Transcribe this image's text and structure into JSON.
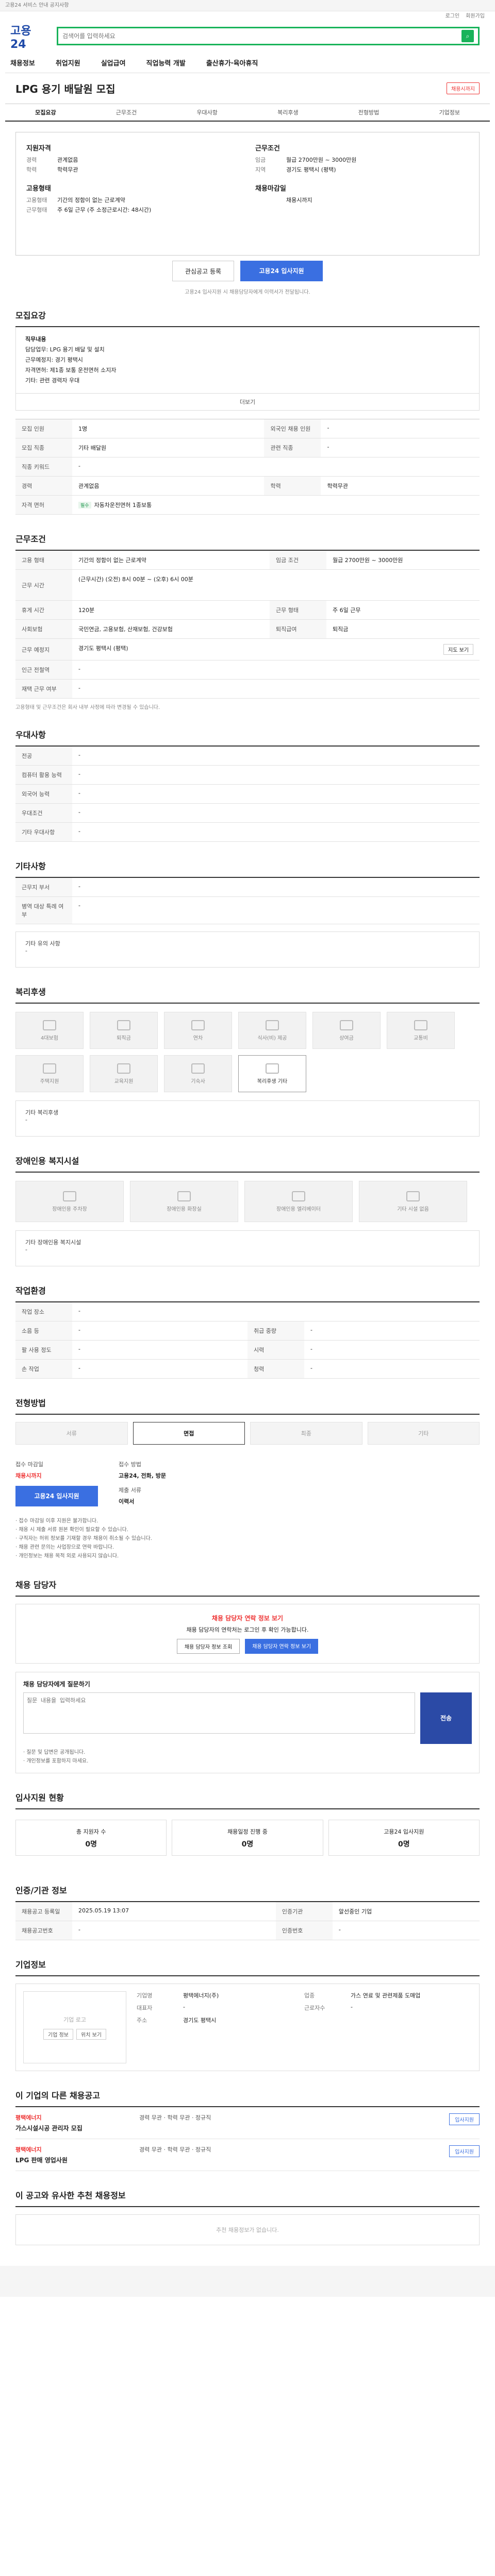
{
  "top": {
    "notice": "고용24 서비스 안내 공지사항",
    "logo": "고용24",
    "search_placeholder": "검색어를 입력하세요",
    "search_btn": "검색",
    "util": [
      "로그인",
      "회원가입"
    ],
    "gnb": [
      "채용정보",
      "취업지원",
      "실업급여",
      "직업능력 개발",
      "출산휴가·육아휴직"
    ]
  },
  "header": {
    "title": "LPG 용기 배달원 모집",
    "badge": "채용시까지",
    "tabs": [
      "모집요강",
      "근무조건",
      "우대사항",
      "복리후생",
      "전형방법",
      "기업정보"
    ]
  },
  "summary": {
    "left": [
      {
        "h": "지원자격",
        "lines": [
          [
            "경력",
            "관계없음"
          ],
          [
            "학력",
            "학력무관"
          ]
        ]
      },
      {
        "h": "고용형태",
        "lines": [
          [
            "고용형태",
            "기간의 정함이 없는 근로계약"
          ],
          [
            "근무형태",
            "주 6일 근무 (주 소정근로시간: 48시간)"
          ]
        ]
      }
    ],
    "right": [
      {
        "h": "근무조건",
        "lines": [
          [
            "임금",
            "월급 2700만원 ~ 3000만원"
          ],
          [
            "지역",
            "경기도 평택시 (평택)"
          ]
        ]
      },
      {
        "h": "채용마감일",
        "lines": [
          [
            "",
            "채용시까지"
          ]
        ]
      }
    ],
    "btn_save": "관심공고 등록",
    "btn_apply": "고용24 입사지원",
    "fine": "고용24 입사지원 시 채용담당자에게 이력서가 전달됩니다."
  },
  "recruit": {
    "h": "모집요강",
    "desc_title": "직무내용",
    "desc": [
      "담당업무: LPG 용기 배달 및 설치",
      "근무예정지: 경기 평택시",
      "자격면허: 제1종 보통 운전면허 소지자",
      "기타: 관련 경력자 우대"
    ],
    "more": "더보기",
    "rows": [
      [
        "모집 인원",
        "1명",
        "외국인 채용 인원",
        "-"
      ],
      [
        "모집 직종",
        "기타 배달원",
        "관련 직종",
        "-"
      ],
      [
        "직종 키워드",
        "-",
        "",
        ""
      ],
      [
        "경력",
        "관계없음",
        "학력",
        "학력무관"
      ],
      [
        "자격 면허",
        "자동차운전면허 1종보통",
        "",
        ""
      ]
    ],
    "tags": [
      "필수",
      "필수"
    ]
  },
  "work": {
    "h": "근무조건",
    "rows": [
      [
        "고용 형태",
        "기간의 정함이 없는 근로계약",
        "임금 조건",
        "월급 2700만원 ~ 3000만원"
      ],
      [
        "근무 시간",
        "(근무시간) (오전) 8시 00분 ~ (오후) 6시 00분",
        "",
        ""
      ],
      [
        "휴게 시간",
        "120분",
        "근무 형태",
        "주 6일 근무"
      ],
      [
        "사회보험",
        "국민연금, 고용보험, 산재보험, 건강보험",
        "퇴직급여",
        "퇴직금"
      ],
      [
        "근무 예정지",
        "경기도 평택시 (평택)",
        "",
        ""
      ],
      [
        "인근 전철역",
        "-",
        "",
        ""
      ],
      [
        "재택 근무 여부",
        "-",
        "",
        ""
      ]
    ],
    "map_btn": "지도 보기",
    "note": "고용형태 및 근무조건은 회사 내부 사정에 따라 변경될 수 있습니다."
  },
  "pref": {
    "h": "우대사항",
    "rows": [
      [
        "전공",
        "-"
      ],
      [
        "컴퓨터 활용 능력",
        "-"
      ],
      [
        "외국어 능력",
        "-"
      ],
      [
        "우대조건",
        "-"
      ],
      [
        "기타 우대사항",
        "-"
      ]
    ]
  },
  "etc": {
    "h": "기타사항",
    "rows": [
      [
        "근무지 부서",
        "-"
      ],
      [
        "병역 대상 특례 여부",
        "-"
      ]
    ],
    "box_title": "기타 유의 사항",
    "box_body": "-"
  },
  "welfare": {
    "h": "복리후생",
    "items": [
      "4대보험",
      "퇴직금",
      "연차",
      "식사(비) 제공",
      "상여금",
      "교통비",
      "주택지원",
      "교육지원",
      "기숙사",
      "복리후생 기타"
    ],
    "box_title": "기타 복리후생",
    "box_body": "-"
  },
  "disabled": {
    "h": "장애인용 복지시설",
    "items": [
      "장애인용 주차장",
      "장애인용 화장실",
      "장애인용 엘리베이터",
      "기타 시설 없음"
    ],
    "box_title": "기타 장애인용 복지시설",
    "box_body": "-"
  },
  "env": {
    "h": "작업환경",
    "rows": [
      [
        "작업 장소",
        "-",
        "",
        ""
      ],
      [
        "소음 등",
        "-",
        "취급 중량",
        "-"
      ],
      [
        "팔 사용 정도",
        "-",
        "시력",
        "-"
      ],
      [
        "손 작업",
        "-",
        "청력",
        "-"
      ]
    ]
  },
  "process": {
    "h": "전형방법",
    "steps": [
      "서류",
      "면접",
      "최종",
      "기타"
    ],
    "apply": [
      {
        "k": "접수 마감일",
        "v": "채용시까지"
      },
      {
        "k": "접수 방법",
        "v": "고용24, 전화, 방문"
      },
      {
        "k": "제출 서류",
        "v": "이력서"
      }
    ],
    "apply_btn": "고용24 입사지원",
    "notes": [
      "· 접수 마감일 이후 지원은 불가합니다.",
      "· 채용 시 제출 서류 원본 확인이 필요할 수 있습니다.",
      "· 구직자는 허위 정보를 기재할 경우 채용이 취소될 수 있습니다.",
      "· 채용 관련 문의는 사업장으로 연락 바랍니다.",
      "· 개인정보는 채용 목적 외로 사용되지 않습니다."
    ]
  },
  "contact": {
    "h": "채용 담당자",
    "warn": "채용 담당자 연락 정보 보기",
    "desc": "채용 담당자의 연락처는 로그인 후 확인 가능합니다.",
    "btn1": "채용 담당자 정보 조회",
    "btn2": "채용 담당자 연락 정보 보기",
    "q_title": "채용 담당자에게 질문하기",
    "q_placeholder": "질문 내용을 입력하세요",
    "q_send": "전송",
    "q_notes": [
      "· 질문 및 답변은 공개됩니다.",
      "· 개인정보를 포함하지 마세요."
    ]
  },
  "status": {
    "h": "입사지원 현황",
    "items": [
      {
        "k": "총 지원자 수",
        "v": "0명"
      },
      {
        "k": "채용일정 진행 중",
        "v": "0명"
      },
      {
        "k": "고용24 입사지원",
        "v": "0명"
      }
    ]
  },
  "reg": {
    "h": "인증/기관 정보",
    "rows": [
      [
        "채용공고 등록일",
        "2025.05.19 13:07",
        "인증기관",
        "알선중인 기업"
      ],
      [
        "채용공고번호",
        "-",
        "인증번호",
        "-"
      ]
    ]
  },
  "company": {
    "h": "기업정보",
    "logo_alt": "기업 로고",
    "mini": [
      "기업 정보",
      "위치 보기"
    ],
    "grid": [
      [
        "기업명",
        "평택에너지(주)",
        "업종",
        "가스 연료 및 관련제품 도매업"
      ],
      [
        "대표자",
        "-",
        "근로자수",
        "-"
      ],
      [
        "주소",
        "경기도 평택시",
        "",
        ""
      ]
    ]
  },
  "others": {
    "h": "이 기업의 다른 채용공고",
    "jobs": [
      {
        "c": "평택에너지",
        "t": "가스시설시공 관리자 모집",
        "m": "경력 무관 · 학력 무관 · 정규직",
        "a": "입사지원"
      },
      {
        "c": "평택에너지",
        "t": "LPG 판매 영업사원",
        "m": "경력 무관 · 학력 무관 · 정규직",
        "a": "입사지원"
      }
    ]
  },
  "recommend": {
    "h": "이 공고와 유사한 추천 채용정보",
    "empty": "추천 채용정보가 없습니다."
  }
}
